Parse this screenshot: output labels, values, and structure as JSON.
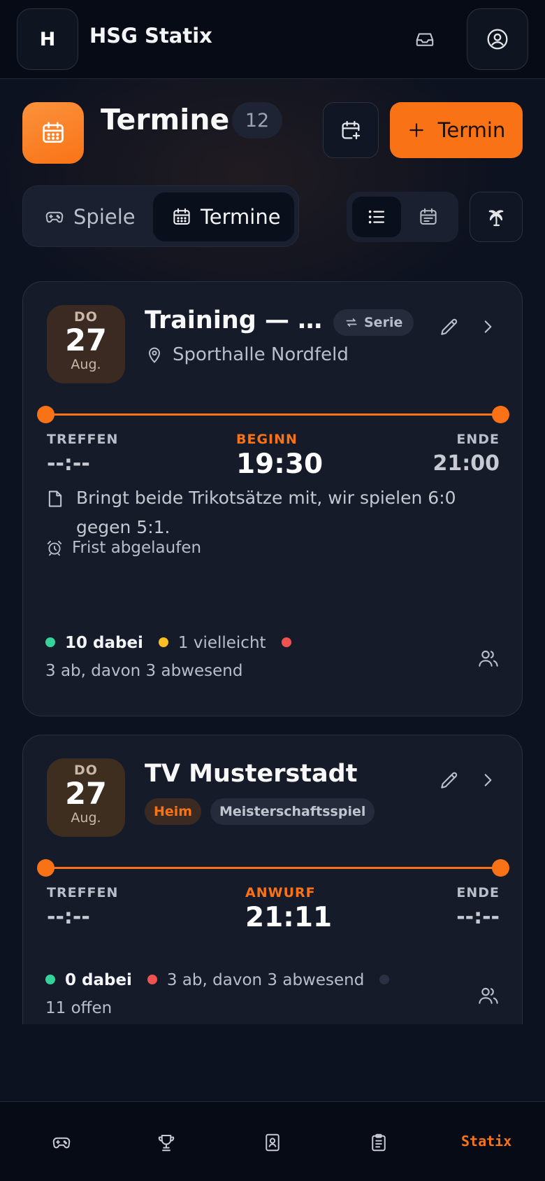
{
  "header": {
    "logo_letter": "H",
    "app_title": "HSG Statix"
  },
  "page": {
    "title": "Termine",
    "count": "12",
    "add_label": "Termin"
  },
  "segments": {
    "games": "Spiele",
    "dates": "Termine"
  },
  "events": [
    {
      "dow": "DO",
      "day": "27",
      "month": "Aug.",
      "title": "Training — …",
      "series_label": "Serie",
      "location": "Sporthalle Nordfeld",
      "meet_label": "TREFFEN",
      "meet_value": "--:--",
      "start_label": "BEGINN",
      "start_value": "19:30",
      "end_label": "ENDE",
      "end_value": "21:00",
      "note": "Bringt beide Trikotsätze mit, wir spielen 6:0 gegen 5:1.",
      "deadline": "Frist abgelaufen",
      "yes": "10 dabei",
      "maybe": "1 vielleicht",
      "no": "3 ab, davon 3 abwesend"
    },
    {
      "dow": "DO",
      "day": "27",
      "month": "Aug.",
      "title": "TV Musterstadt",
      "tag_home": "Heim",
      "tag_type": "Meisterschaftsspiel",
      "meet_label": "TREFFEN",
      "meet_value": "--:--",
      "start_label": "ANWURF",
      "start_value": "21:11",
      "end_label": "ENDE",
      "end_value": "--:--",
      "yes": "0 dabei",
      "no": "3 ab, davon 3 abwesend",
      "open": "11 offen"
    }
  ],
  "bottom_nav": {
    "brand": "Statix"
  },
  "colors": {
    "accent": "#f97316",
    "background": "#0d1220",
    "card": "#161b2a",
    "yes": "#34d399",
    "maybe": "#fbbf24",
    "no": "#f05252"
  }
}
